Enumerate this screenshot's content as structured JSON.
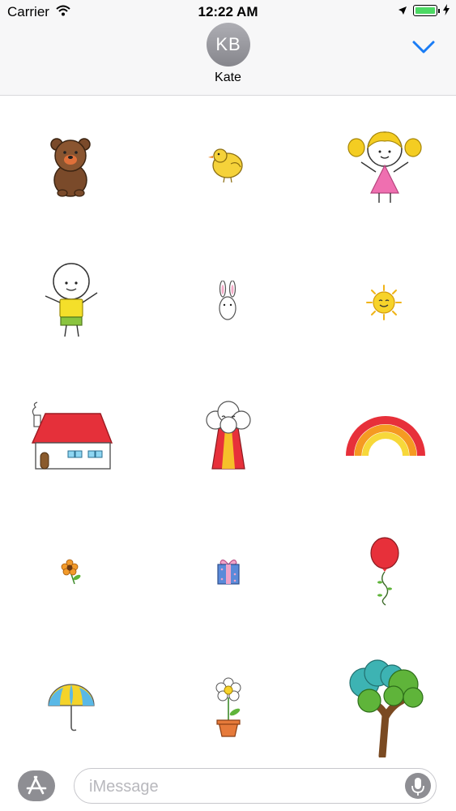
{
  "status_bar": {
    "carrier": "Carrier",
    "time": "12:22 AM",
    "wifi_icon": "wifi-icon",
    "location_icon": "location-arrow-icon",
    "battery_icon": "battery-charging-icon",
    "battery_color": "#4cd964"
  },
  "header": {
    "avatar_initials": "KB",
    "contact_name": "Kate",
    "collapse_icon": "chevron-down-icon",
    "accent_color": "#1a7cf5"
  },
  "stickers": [
    {
      "name": "bear"
    },
    {
      "name": "chick"
    },
    {
      "name": "girl"
    },
    {
      "name": "boy"
    },
    {
      "name": "bunny"
    },
    {
      "name": "sun"
    },
    {
      "name": "house"
    },
    {
      "name": "volcano"
    },
    {
      "name": "rainbow"
    },
    {
      "name": "flower"
    },
    {
      "name": "gift"
    },
    {
      "name": "balloon"
    },
    {
      "name": "umbrella"
    },
    {
      "name": "potted-daisy"
    },
    {
      "name": "tree"
    }
  ],
  "composer": {
    "placeholder": "iMessage",
    "app_store_icon": "app-store-icon",
    "mic_icon": "microphone-icon"
  }
}
